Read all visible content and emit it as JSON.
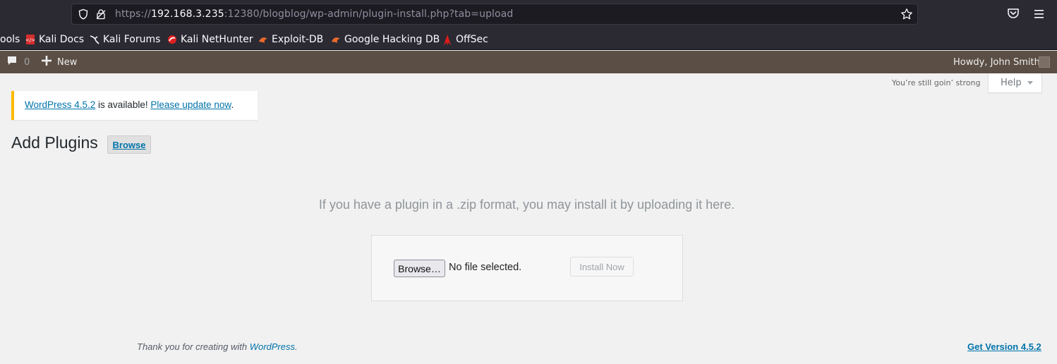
{
  "browser": {
    "url_scheme": "https://",
    "url_host": "192.168.3.235",
    "url_rest": ":12380/blogblog/wp-admin/plugin-install.php?tab=upload"
  },
  "bookmarks": [
    {
      "label": "ools",
      "icon": "tools-icon"
    },
    {
      "label": "Kali Docs",
      "icon": "kali-docs-icon"
    },
    {
      "label": "Kali Forums",
      "icon": "kali-forums-icon"
    },
    {
      "label": "Kali NetHunter",
      "icon": "kali-nethunter-icon"
    },
    {
      "label": "Exploit-DB",
      "icon": "exploit-db-icon"
    },
    {
      "label": "Google Hacking DB",
      "icon": "ghdb-icon"
    },
    {
      "label": "OffSec",
      "icon": "offsec-icon"
    }
  ],
  "adminbar": {
    "comments_count": "0",
    "new_label": "New",
    "howdy": "Howdy, John Smith"
  },
  "screen_meta": {
    "still_strong": "You’re still goin’ strong",
    "help_label": "Help"
  },
  "notice": {
    "link_version": "WordPress 4.5.2",
    "middle_text": " is available! ",
    "link_update": "Please update now",
    "end": "."
  },
  "page": {
    "title": "Add Plugins",
    "browse_label": "Browse"
  },
  "upload": {
    "help_text": "If you have a plugin in a .zip format, you may install it by uploading it here.",
    "file_button": "Browse…",
    "file_status": "No file selected.",
    "install_label": "Install Now"
  },
  "footer": {
    "thanks_prefix": "Thank you for creating with ",
    "thanks_link": "WordPress",
    "thanks_suffix": ".",
    "version_link": "Get Version 4.5.2"
  },
  "colors": {
    "adminbar_bg": "#5b4e45",
    "link": "#0073aa",
    "notice_border": "#ffba00"
  }
}
